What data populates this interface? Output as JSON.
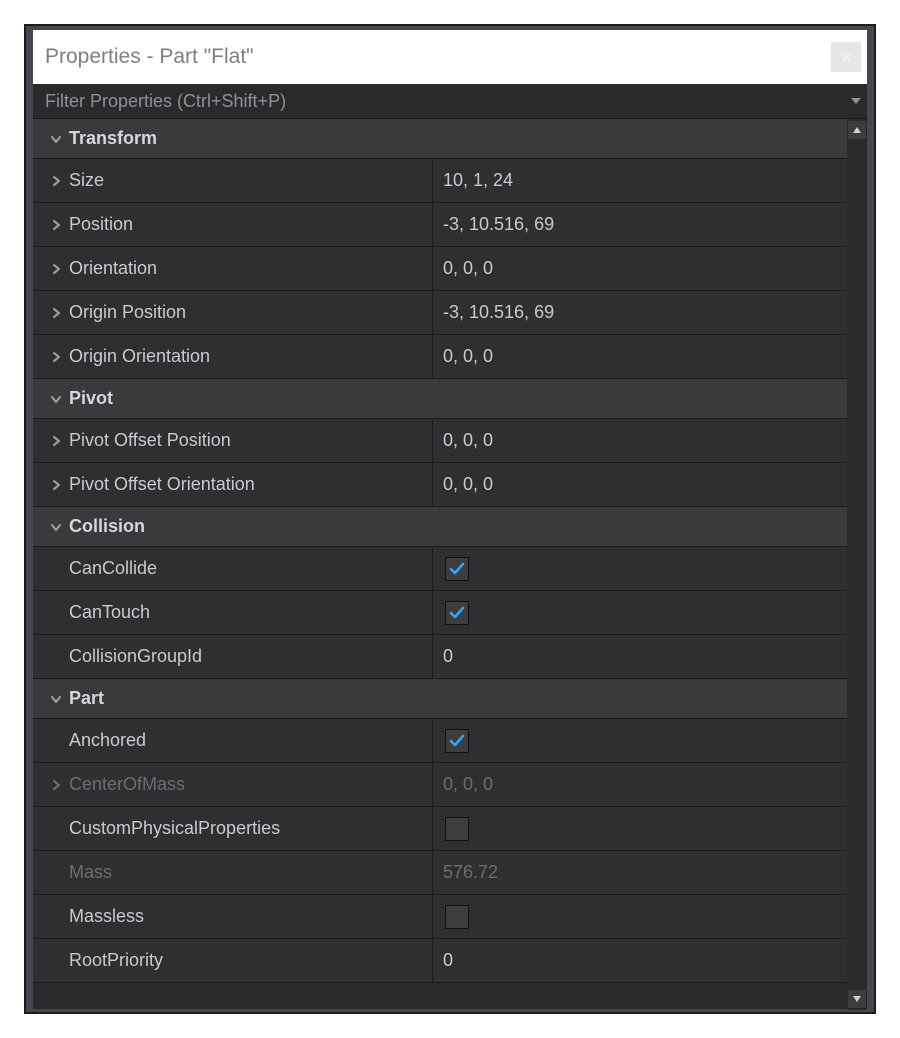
{
  "title": "Properties - Part \"Flat\"",
  "filter_placeholder": "Filter Properties (Ctrl+Shift+P)",
  "sections": [
    {
      "name": "Transform",
      "expanded": true,
      "rows": [
        {
          "name": "Size",
          "value": "10, 1, 24",
          "expandable": true
        },
        {
          "name": "Position",
          "value": "-3, 10.516, 69",
          "expandable": true
        },
        {
          "name": "Orientation",
          "value": "0, 0, 0",
          "expandable": true
        },
        {
          "name": "Origin Position",
          "value": "-3, 10.516, 69",
          "expandable": true
        },
        {
          "name": "Origin Orientation",
          "value": "0, 0, 0",
          "expandable": true
        }
      ]
    },
    {
      "name": "Pivot",
      "expanded": true,
      "rows": [
        {
          "name": "Pivot Offset Position",
          "value": "0, 0, 0",
          "expandable": true
        },
        {
          "name": "Pivot Offset Orientation",
          "value": "0, 0, 0",
          "expandable": true
        }
      ]
    },
    {
      "name": "Collision",
      "expanded": true,
      "rows": [
        {
          "name": "CanCollide",
          "type": "checkbox",
          "checked": true
        },
        {
          "name": "CanTouch",
          "type": "checkbox",
          "checked": true
        },
        {
          "name": "CollisionGroupId",
          "value": "0"
        }
      ]
    },
    {
      "name": "Part",
      "expanded": true,
      "rows": [
        {
          "name": "Anchored",
          "type": "checkbox",
          "checked": true
        },
        {
          "name": "CenterOfMass",
          "value": "0, 0, 0",
          "expandable": true,
          "disabled": true
        },
        {
          "name": "CustomPhysicalProperties",
          "type": "checkbox",
          "checked": false
        },
        {
          "name": "Mass",
          "value": "576.72",
          "disabled": true
        },
        {
          "name": "Massless",
          "type": "checkbox",
          "checked": false
        },
        {
          "name": "RootPriority",
          "value": "0"
        }
      ]
    }
  ]
}
